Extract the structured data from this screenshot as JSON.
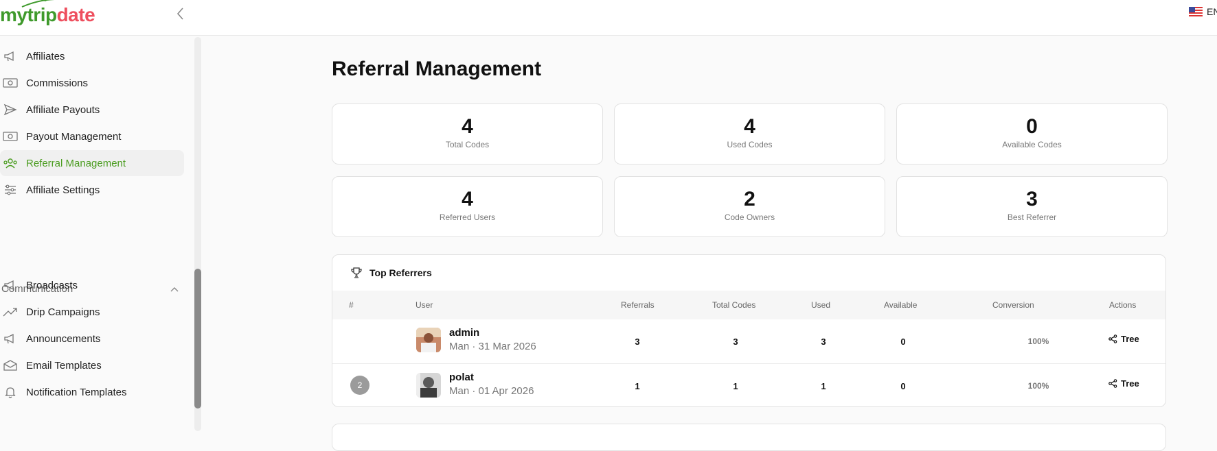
{
  "app": {
    "logo_part1": "mytrip",
    "logo_part2": "date",
    "language": "EN"
  },
  "sidebar": {
    "items": [
      {
        "label": "Affiliates",
        "icon": "megaphone-icon"
      },
      {
        "label": "Commissions",
        "icon": "banknote-icon"
      },
      {
        "label": "Affiliate Payouts",
        "icon": "send-icon"
      },
      {
        "label": "Payout Management",
        "icon": "banknote-icon"
      },
      {
        "label": "Referral Management",
        "icon": "users-icon",
        "active": true
      },
      {
        "label": "Affiliate Settings",
        "icon": "sliders-icon"
      }
    ],
    "section_label": "Communication",
    "section_items": [
      {
        "label": "Broadcasts",
        "icon": "megaphone-icon"
      },
      {
        "label": "Drip Campaigns",
        "icon": "trending-up-icon"
      },
      {
        "label": "Announcements",
        "icon": "megaphone-icon"
      },
      {
        "label": "Email Templates",
        "icon": "envelope-open-icon"
      },
      {
        "label": "Notification Templates",
        "icon": "bell-icon"
      }
    ]
  },
  "main": {
    "title": "Referral Management",
    "stats": [
      {
        "value": "4",
        "label": "Total Codes"
      },
      {
        "value": "4",
        "label": "Used Codes"
      },
      {
        "value": "0",
        "label": "Available Codes"
      },
      {
        "value": "4",
        "label": "Referred Users"
      },
      {
        "value": "2",
        "label": "Code Owners"
      },
      {
        "value": "3",
        "label": "Best Referrer"
      }
    ],
    "top_referrers": {
      "title": "Top Referrers",
      "columns": [
        "#",
        "User",
        "Referrals",
        "Total Codes",
        "Used",
        "Available",
        "Conversion",
        "Actions"
      ],
      "rows": [
        {
          "rank": "",
          "name": "admin",
          "sub": "Man · 31 Mar 2026",
          "referrals": "3",
          "total_codes": "3",
          "used": "3",
          "available": "0",
          "conversion": "100%",
          "action": "Tree"
        },
        {
          "rank": "2",
          "name": "polat",
          "sub": "Man · 01 Apr 2026",
          "referrals": "1",
          "total_codes": "1",
          "used": "1",
          "available": "0",
          "conversion": "100%",
          "action": "Tree"
        }
      ]
    }
  },
  "colors": {
    "brand_green": "#3f9a2c",
    "brand_red": "#ee4f5e",
    "active_green": "#4a9c1f"
  }
}
